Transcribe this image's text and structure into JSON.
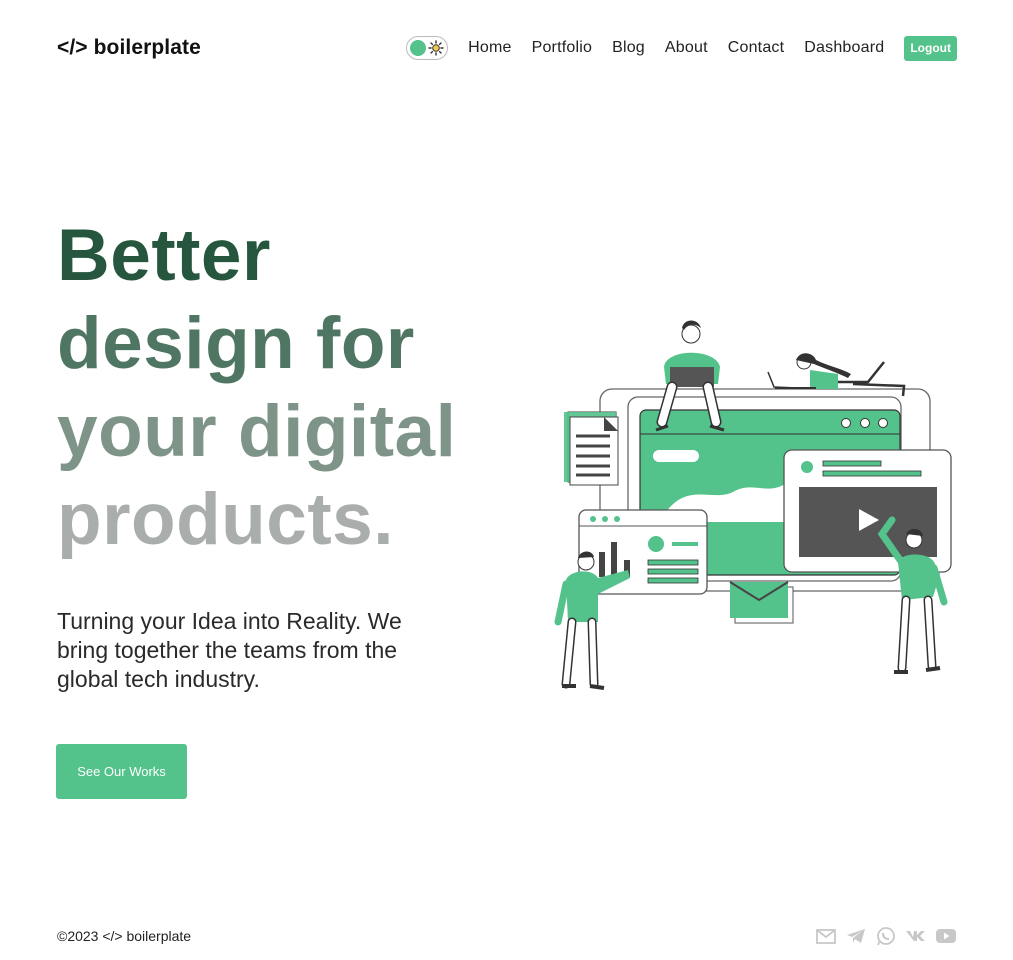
{
  "header": {
    "logo": "</> boilerplate",
    "nav": [
      "Home",
      "Portfolio",
      "Blog",
      "About",
      "Contact",
      "Dashboard"
    ],
    "logout": "Logout",
    "theme_toggle_icon": "sun-icon"
  },
  "hero": {
    "title_lines": [
      "Better",
      "design for",
      "your digital",
      "products."
    ],
    "subtitle": "Turning your Idea into Reality. We bring together the teams from the global tech industry.",
    "cta": "See Our Works"
  },
  "footer": {
    "copyright": "©2023 </> boilerplate",
    "social_icons": [
      "mail-icon",
      "telegram-icon",
      "whatsapp-icon",
      "vk-icon",
      "youtube-icon"
    ]
  },
  "colors": {
    "accent": "#53c28b",
    "title_1": "#26573e",
    "title_2": "#4f7563",
    "title_3": "#7f9488",
    "title_4": "#a9adab"
  }
}
